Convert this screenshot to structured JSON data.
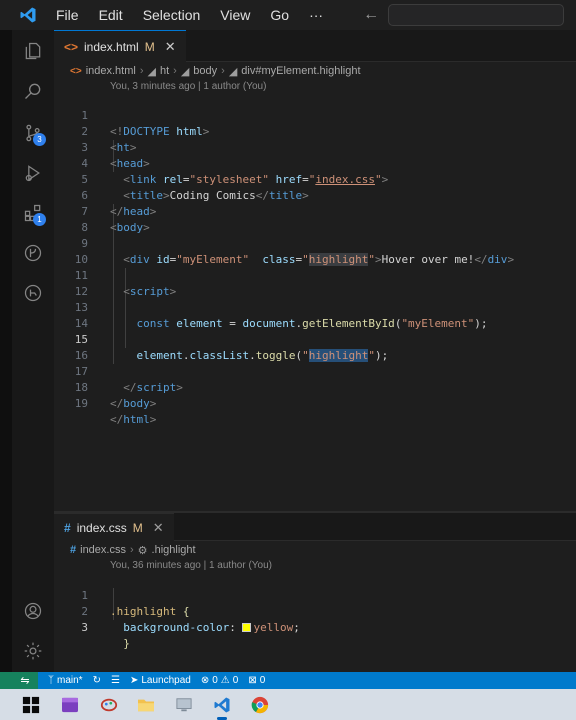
{
  "titlebar": {
    "menu": [
      "File",
      "Edit",
      "Selection",
      "View",
      "Go",
      "···"
    ],
    "back_icon": "arrow-left-icon",
    "forward_icon": "arrow-right-icon"
  },
  "activity_bar": {
    "source_control_badge": "3",
    "extensions_badge": "1"
  },
  "editor_top": {
    "tab": {
      "label": "index.html",
      "modified": "M",
      "close": "✕"
    },
    "breadcrumb": [
      "index.html",
      "ht",
      "body",
      "div#myElement.highlight"
    ],
    "blame": "You, 3 minutes ago | 1 author (You)",
    "lines": [
      {
        "n": "1"
      },
      {
        "n": "2"
      },
      {
        "n": "3"
      },
      {
        "n": "4"
      },
      {
        "n": "5"
      },
      {
        "n": "6"
      },
      {
        "n": "7"
      },
      {
        "n": "8"
      },
      {
        "n": "9"
      },
      {
        "n": "10"
      },
      {
        "n": "11"
      },
      {
        "n": "12"
      },
      {
        "n": "13"
      },
      {
        "n": "14"
      },
      {
        "n": "15"
      },
      {
        "n": "16"
      },
      {
        "n": "17"
      },
      {
        "n": "18"
      },
      {
        "n": "19"
      }
    ],
    "code": {
      "l1_a": "<!",
      "l1_b": "DOCTYPE",
      "l1_c": "html",
      "l1_d": ">",
      "l2": "ht",
      "l3": "head",
      "l4_tag": "link",
      "l4_rel": "rel",
      "l4_rel_v": "\"stylesheet\"",
      "l4_href": "href",
      "l4_href_v1": "\"",
      "l4_href_v2": "index.css",
      "l4_href_v3": "\"",
      "l5_tag": "title",
      "l5_text": "Coding Comics",
      "l6": "head",
      "l7": "body",
      "l9_tag": "div",
      "l9_id": "id",
      "l9_id_v": "\"myElement\"",
      "l9_class": "class",
      "l9_class_v1": "\"",
      "l9_class_v2": "highlight",
      "l9_class_v3": "\"",
      "l9_text": "Hover over me!",
      "l11": "script",
      "l13_kw": "const",
      "l13_var": "element",
      "l13_eq": " = ",
      "l13_obj": "document",
      "l13_fn": "getElementById",
      "l13_arg": "\"myElement\"",
      "l13_end": ");",
      "l15_obj": "element",
      "l15_prop": "classList",
      "l15_fn": "toggle",
      "l15_q1": "\"",
      "l15_arg": "highlight",
      "l15_q2": "\"",
      "l15_end": ");",
      "l17": "script",
      "l18": "body",
      "l19": "html"
    }
  },
  "editor_bottom": {
    "tab": {
      "label": "index.css",
      "modified": "M",
      "close": "✕"
    },
    "breadcrumb": [
      "index.css",
      ".highlight"
    ],
    "blame": "You, 36 minutes ago | 1 author (You)",
    "lines": [
      {
        "n": "1"
      },
      {
        "n": "2"
      },
      {
        "n": "3"
      }
    ],
    "code": {
      "l1_sel": ".highlight",
      "l1_brace": " {",
      "l2_prop": "background-color",
      "l2_colon": ": ",
      "l2_val": "yellow",
      "l2_semi": ";",
      "l3": "}"
    },
    "swatch_color": "#ffff00"
  },
  "statusbar": {
    "branch": "main*",
    "launchpad": "Launchpad",
    "errors": "0",
    "warnings": "0",
    "ports": "0"
  },
  "taskbar": {
    "icons": [
      "windows-start-icon",
      "media-app-icon",
      "paint-app-icon",
      "file-explorer-icon",
      "display-app-icon",
      "vscode-icon",
      "chrome-icon"
    ]
  },
  "colors": {
    "accent": "#007acc",
    "editor_bg": "#1e1e1e",
    "tag": "#569cd6",
    "string": "#ce9178",
    "attribute": "#9cdcfe",
    "function": "#dcdcaa",
    "selector": "#d7ba7d"
  }
}
